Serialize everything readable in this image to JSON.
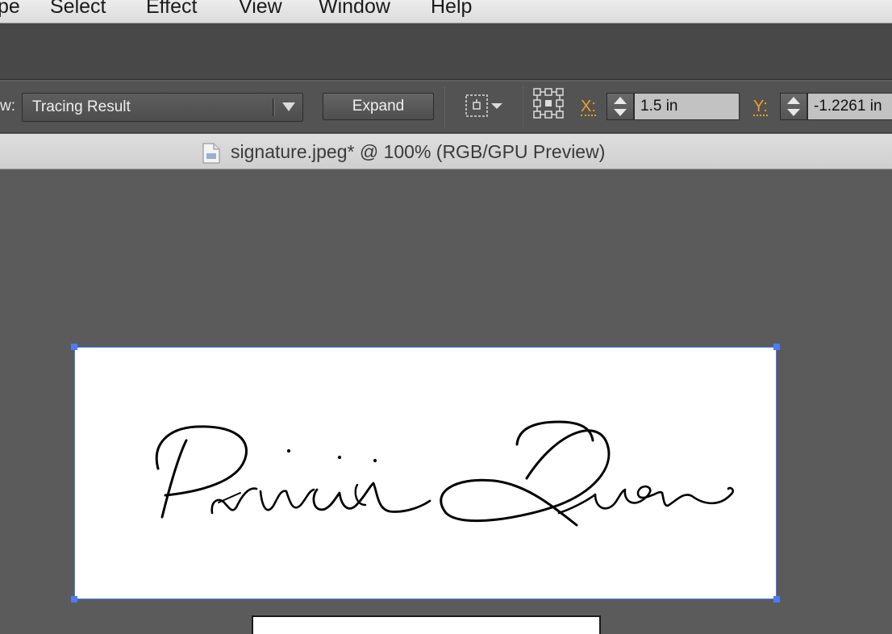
{
  "menubar": {
    "items": [
      {
        "key": "type",
        "label": "pe"
      },
      {
        "key": "select",
        "label": "Select"
      },
      {
        "key": "effect",
        "label": "Effect"
      },
      {
        "key": "view",
        "label": "View"
      },
      {
        "key": "window",
        "label": "Window"
      },
      {
        "key": "help",
        "label": "Help"
      }
    ]
  },
  "controlbar": {
    "view_label": "w:",
    "view_dropdown_value": "Tracing Result",
    "expand_label": "Expand",
    "x_label": "X:",
    "x_value": "1.5 in",
    "y_label": "Y:",
    "y_value": "-1.2261 in"
  },
  "document": {
    "title": "signature.jpeg* @ 100% (RGB/GPU Preview)"
  },
  "artboard": {
    "content": "signature-artwork",
    "selection_color": "#4a7cf5",
    "signature_text": "Patricia Quon"
  },
  "colors": {
    "accent_orange": "#f0a020",
    "selection_blue": "#4a7cf5",
    "canvas": "#5b5b5b"
  }
}
